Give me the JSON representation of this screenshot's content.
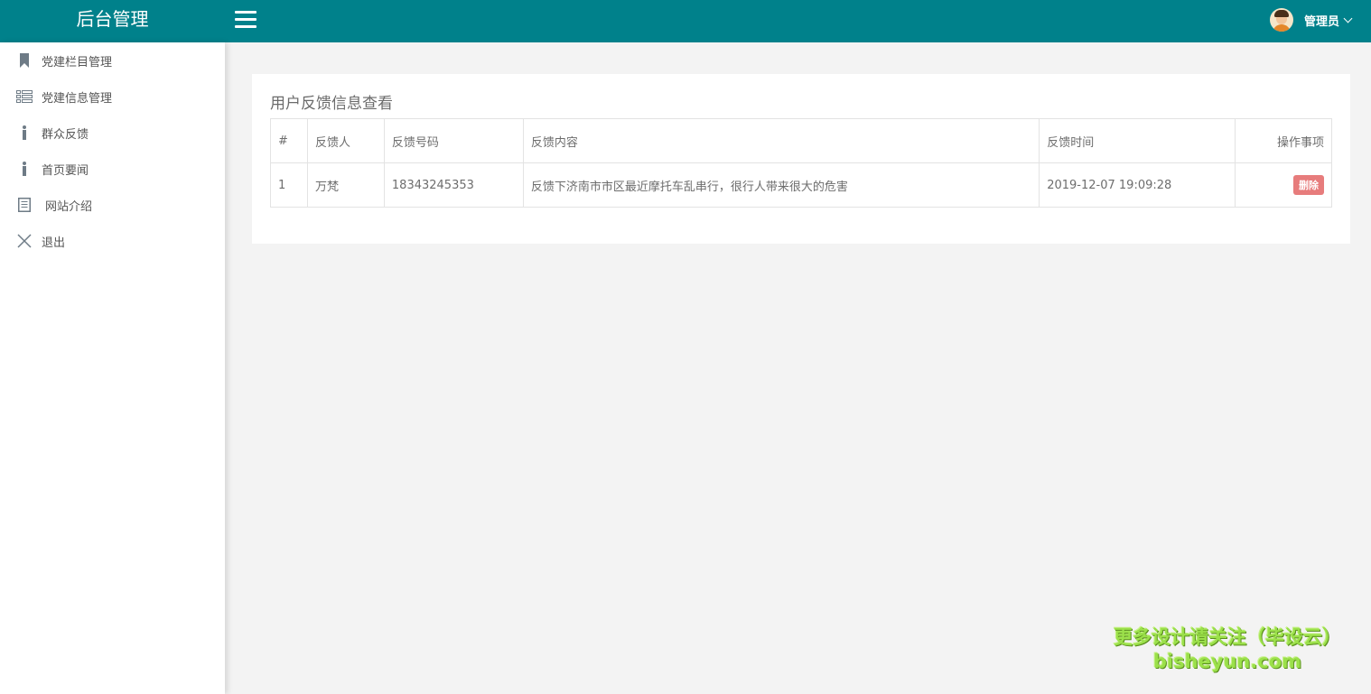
{
  "header": {
    "brand": "后台管理",
    "user_name": "管理员"
  },
  "sidebar": {
    "items": [
      {
        "label": "党建栏目管理",
        "icon": "bookmark-icon"
      },
      {
        "label": "党建信息管理",
        "icon": "list-icon"
      },
      {
        "label": "群众反馈",
        "icon": "info-icon"
      },
      {
        "label": "首页要闻",
        "icon": "info-icon"
      },
      {
        "label": "网站介绍",
        "icon": "document-icon"
      },
      {
        "label": "退出",
        "icon": "close-icon"
      }
    ]
  },
  "main": {
    "title": "用户反馈信息查看",
    "table": {
      "headers": [
        "#",
        "反馈人",
        "反馈号码",
        "反馈内容",
        "反馈时间",
        "操作事项"
      ],
      "rows": [
        {
          "index": "1",
          "name": "万梵",
          "phone": "18343245353",
          "content": "反馈下济南市市区最近摩托车乱串行，很行人带来很大的危害",
          "time": "2019-12-07 19:09:28",
          "action": "删除"
        }
      ]
    }
  },
  "watermark": {
    "line1": "更多设计请关注（毕设云）",
    "line2": "bisheyun.com"
  },
  "colors": {
    "header_bg": "#00818b",
    "delete_button": "#e77c7c",
    "watermark": "#9be04a"
  }
}
